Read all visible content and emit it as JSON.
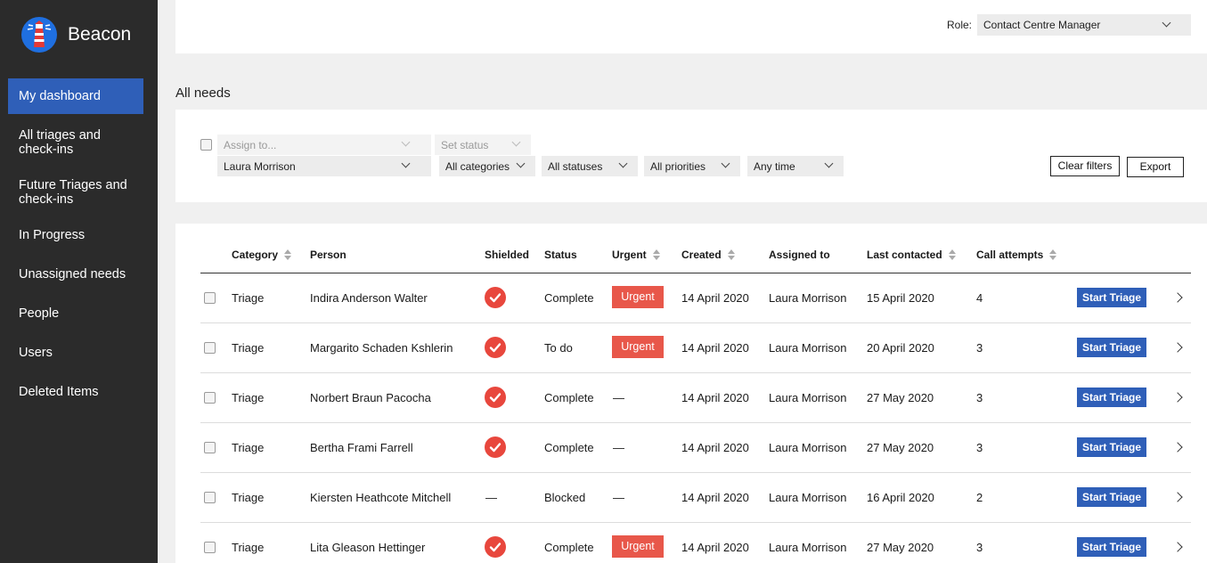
{
  "app": {
    "name": "Beacon"
  },
  "sidebar": {
    "items": [
      {
        "label": "My dashboard"
      },
      {
        "label": "All triages and check-ins"
      },
      {
        "label": "Future Triages and check-ins"
      },
      {
        "label": "In Progress"
      },
      {
        "label": "Unassigned needs"
      },
      {
        "label": "People"
      },
      {
        "label": "Users"
      },
      {
        "label": "Deleted Items"
      }
    ]
  },
  "header": {
    "role_label": "Role:",
    "role_value": "Contact Centre Manager"
  },
  "section": {
    "title": "All needs"
  },
  "filters": {
    "assign_to_placeholder": "Assign to...",
    "set_status_placeholder": "Set status",
    "assignee": "Laura Morrison",
    "category": "All categories",
    "status": "All statuses",
    "priority": "All priorities",
    "time": "Any time",
    "clear_label": "Clear filters",
    "export_label": "Export"
  },
  "table": {
    "columns": {
      "category": "Category",
      "person": "Person",
      "shielded": "Shielded",
      "status": "Status",
      "urgent": "Urgent",
      "created": "Created",
      "assigned_to": "Assigned to",
      "last_contacted": "Last contacted",
      "call_attempts": "Call attempts"
    },
    "action_label": "Start Triage",
    "urgent_label": "Urgent",
    "dash": "—",
    "rows": [
      {
        "category": "Triage",
        "person": "Indira Anderson Walter",
        "shielded": true,
        "status": "Complete",
        "urgent": true,
        "created": "14 April 2020",
        "assigned_to": "Laura Morrison",
        "last_contacted": "15 April 2020",
        "call_attempts": "4"
      },
      {
        "category": "Triage",
        "person": "Margarito Schaden Kshlerin",
        "shielded": true,
        "status": "To do",
        "urgent": true,
        "created": "14 April 2020",
        "assigned_to": "Laura Morrison",
        "last_contacted": "20 April 2020",
        "call_attempts": "3"
      },
      {
        "category": "Triage",
        "person": "Norbert Braun Pacocha",
        "shielded": true,
        "status": "Complete",
        "urgent": false,
        "created": "14 April 2020",
        "assigned_to": "Laura Morrison",
        "last_contacted": "27 May 2020",
        "call_attempts": "3"
      },
      {
        "category": "Triage",
        "person": "Bertha Frami Farrell",
        "shielded": true,
        "status": "Complete",
        "urgent": false,
        "created": "14 April 2020",
        "assigned_to": "Laura Morrison",
        "last_contacted": "27 May 2020",
        "call_attempts": "3"
      },
      {
        "category": "Triage",
        "person": "Kiersten Heathcote Mitchell",
        "shielded": false,
        "status": "Blocked",
        "urgent": false,
        "created": "14 April 2020",
        "assigned_to": "Laura Morrison",
        "last_contacted": "16 April 2020",
        "call_attempts": "2"
      },
      {
        "category": "Triage",
        "person": "Lita Gleason Hettinger",
        "shielded": true,
        "status": "Complete",
        "urgent": true,
        "created": "14 April 2020",
        "assigned_to": "Laura Morrison",
        "last_contacted": "27 May 2020",
        "call_attempts": "3"
      }
    ]
  },
  "colors": {
    "sidebar": "#2b2b2b",
    "accent": "#2f5fb8",
    "urgent": "#e8574a",
    "shielded": "#e8473d"
  },
  "icons": {
    "logo": "lighthouse-icon",
    "shielded": "check-circle-icon",
    "row_open": "chevron-right-icon",
    "dropdown": "chevron-down-icon",
    "sort": "sort-icon"
  }
}
